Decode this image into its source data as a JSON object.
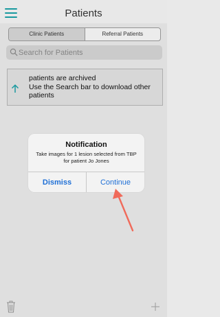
{
  "header": {
    "title": "Patients",
    "menu_icon": "hamburger-menu-icon"
  },
  "segments": [
    {
      "label": "Clinic Patients",
      "selected": true
    },
    {
      "label": "Referral Patients",
      "selected": false
    }
  ],
  "search": {
    "placeholder": "Search for Patients",
    "value": "",
    "icon": "search-icon"
  },
  "banner": {
    "title": "patients are archived",
    "body": "Use the Search bar to download other patients",
    "icon": "upload-arrow-icon"
  },
  "dialog": {
    "title": "Notification",
    "message": "Take images for 1 lesion selected from TBP for patient Jo Jones",
    "dismiss_label": "Dismiss",
    "continue_label": "Continue"
  },
  "toolbar": {
    "left_icon": "trash-icon",
    "right_icon": "plus-icon"
  },
  "colors": {
    "accent_teal": "#1aa0a6",
    "button_blue": "#1e6fd6",
    "annotation_arrow": "#f06a5a",
    "background": "#e9e9e9"
  }
}
